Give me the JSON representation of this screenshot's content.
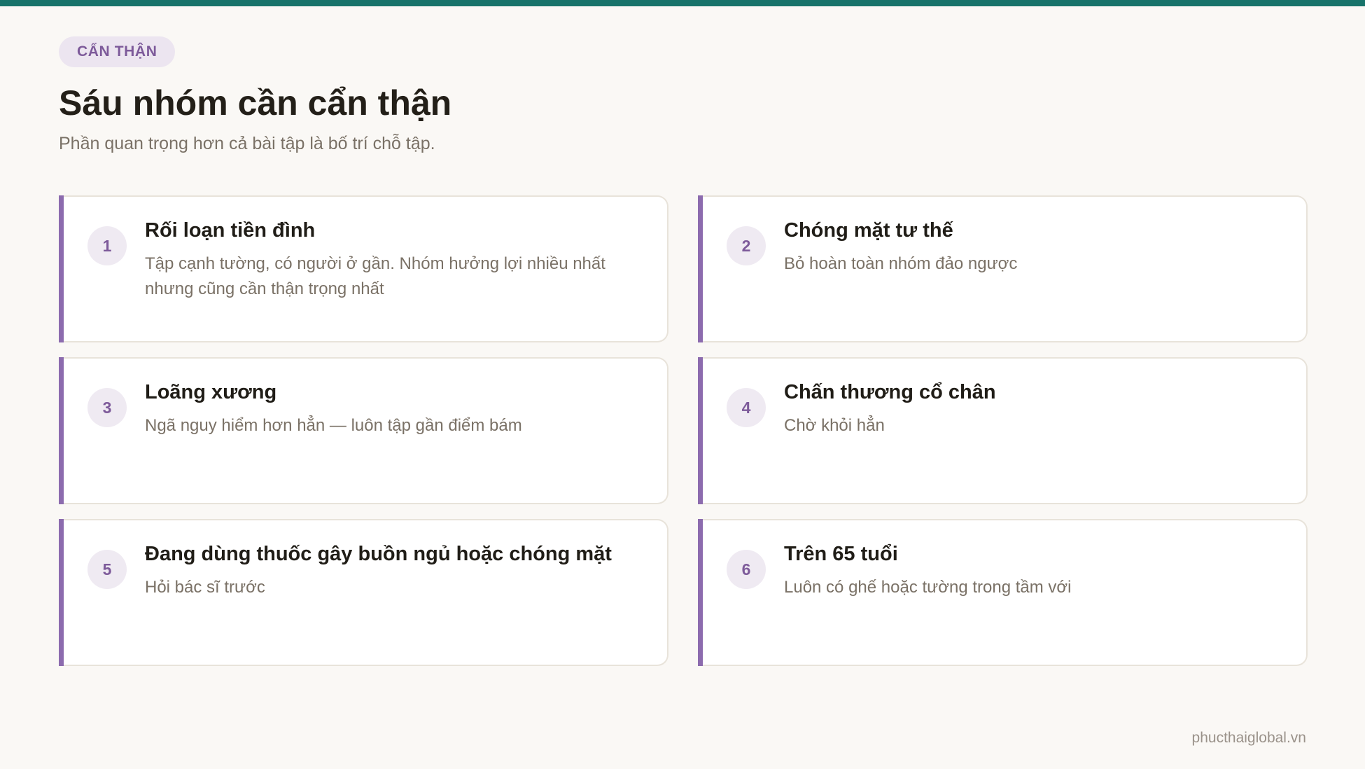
{
  "tag": "CẨN THẬN",
  "title": "Sáu nhóm cần cẩn thận",
  "subtitle": "Phần quan trọng hơn cả bài tập là bố trí chỗ tập.",
  "cards": [
    {
      "number": "1",
      "title": "Rối loạn tiền đình",
      "desc": "Tập cạnh tường, có người ở gần. Nhóm hưởng lợi nhiều nhất nhưng cũng cần thận trọng nhất"
    },
    {
      "number": "2",
      "title": "Chóng mặt tư thế",
      "desc": "Bỏ hoàn toàn nhóm đảo ngược"
    },
    {
      "number": "3",
      "title": "Loãng xương",
      "desc": "Ngã nguy hiểm hơn hẳn — luôn tập gần điểm bám"
    },
    {
      "number": "4",
      "title": "Chấn thương cổ chân",
      "desc": "Chờ khỏi hẳn"
    },
    {
      "number": "5",
      "title": "Đang dùng thuốc gây buồn ngủ hoặc chóng mặt",
      "desc": "Hỏi bác sĩ trước"
    },
    {
      "number": "6",
      "title": "Trên 65 tuổi",
      "desc": "Luôn có ghế hoặc tường trong tầm với"
    }
  ],
  "footer": "phucthaiglobal.vn",
  "colors": {
    "top_bar": "#17736A",
    "accent": "#8C6BAE",
    "tag_bg": "#ECE5F0",
    "background": "#FAF8F5"
  }
}
